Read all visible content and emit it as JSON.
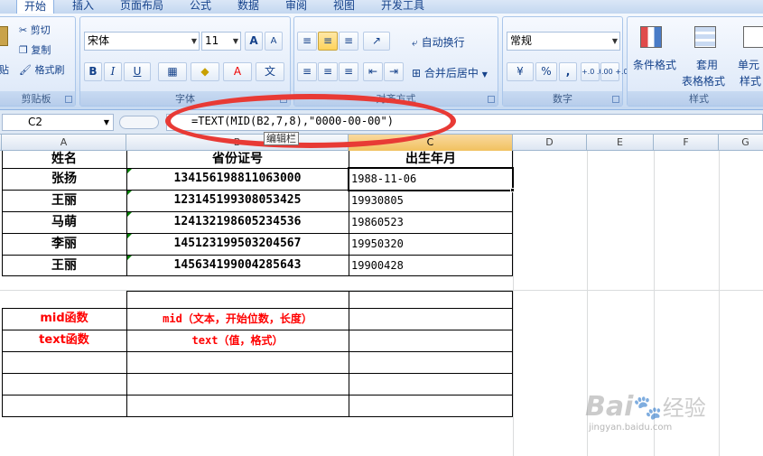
{
  "tabs": [
    "开始",
    "插入",
    "页面布局",
    "公式",
    "数据",
    "审阅",
    "视图",
    "开发工具"
  ],
  "clipboard": {
    "cut": "剪切",
    "copy": "复制",
    "format_painter": "格式刷",
    "paste_partial": "贴",
    "label": "剪贴板"
  },
  "font": {
    "name": "宋体",
    "size": "11",
    "bold": "B",
    "italic": "I",
    "underline": "U",
    "label": "字体",
    "grow": "A",
    "wen": "文"
  },
  "alignment": {
    "wrap": "自动换行",
    "merge": "合并后居中",
    "label": "对齐方式"
  },
  "number": {
    "format": "常规",
    "label": "数字",
    "percent": "%",
    "comma": ",",
    "inc_decimal": "+.0 .00",
    "dec_decimal": ".00 +.0"
  },
  "styles": {
    "conditional": "条件格式",
    "table1": "套用",
    "table2": "表格格式",
    "cell1": "单元",
    "cell2": "样式",
    "label": "样式"
  },
  "formula_bar": {
    "cell_ref": "C2",
    "formula": "=TEXT(MID(B2,7,8),\"0000-00-00\")",
    "tooltip": "编辑栏"
  },
  "columns": [
    "A",
    "B",
    "C",
    "D",
    "E",
    "F",
    "G"
  ],
  "headers": {
    "name": "姓名",
    "id": "省份证号",
    "birth": "出生年月"
  },
  "rows": [
    {
      "name": "张扬",
      "id": "134156198811063000",
      "birth": "1988-11-06"
    },
    {
      "name": "王丽",
      "id": "123145199308053425",
      "birth": "19930805"
    },
    {
      "name": "马萌",
      "id": "124132198605234536",
      "birth": "19860523"
    },
    {
      "name": "李丽",
      "id": "145123199503204567",
      "birth": "19950320"
    },
    {
      "name": "王丽",
      "id": "145634199004285643",
      "birth": "19900428"
    }
  ],
  "notes": [
    {
      "label": "mid函数",
      "desc": "mid（文本，开始位数，长度）"
    },
    {
      "label": "text函数",
      "desc": "text（值，格式）"
    }
  ],
  "watermark": {
    "brand": "Bai",
    "brand2": "经验",
    "url": "jingyan.baidu.com"
  },
  "colors": {
    "accent_red": "#e83a35",
    "grid_border": "#000000"
  }
}
